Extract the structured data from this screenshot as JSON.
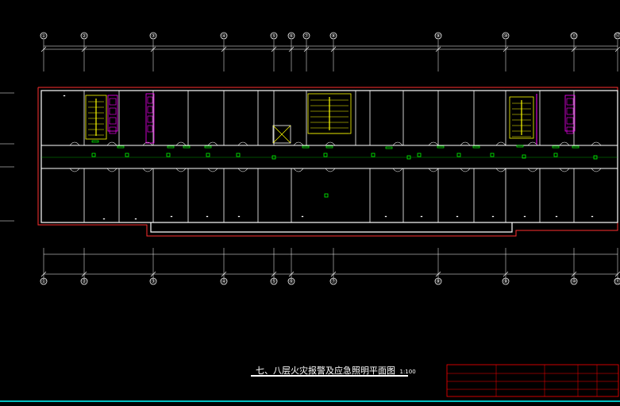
{
  "drawing": {
    "title": "七、八层火灾报警及应急照明平面图",
    "scale": "1:100"
  },
  "grid_axes": {
    "top": [
      "①",
      "②",
      "③",
      "④",
      "⑤",
      "⑥",
      "⑦",
      "⑧",
      "⑨",
      "⑩",
      "⑪",
      "⑫"
    ],
    "bottom": [
      "①",
      "②",
      "③",
      "④",
      "⑤",
      "⑥",
      "⑦",
      "⑧",
      "⑨",
      "⑩",
      "⑪",
      "⑫"
    ]
  },
  "colors": {
    "background": "#000000",
    "wall": "#ffffff",
    "boundary": "#ff3030",
    "fire_device": "#00ff00",
    "stair": "#ffff00",
    "riser": "#ff00ff",
    "border": "#00ffff",
    "title_block": "#ff0000"
  }
}
